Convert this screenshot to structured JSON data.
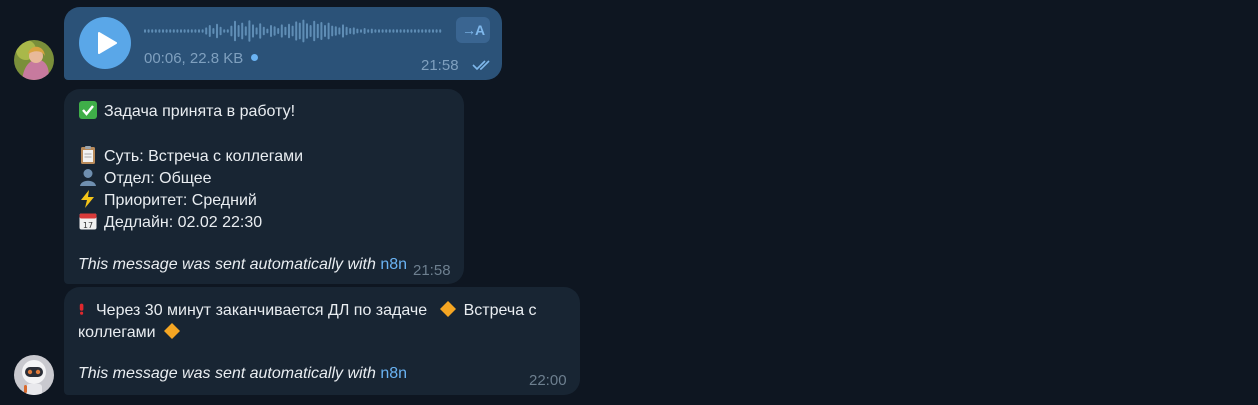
{
  "voice_message": {
    "duration_size": "00:06, 22.8 KB",
    "time": "21:58",
    "transcribe_label": "→A",
    "waveform": [
      0.15,
      0.15,
      0.15,
      0.15,
      0.15,
      0.15,
      0.15,
      0.15,
      0.15,
      0.15,
      0.15,
      0.15,
      0.15,
      0.15,
      0.15,
      0.15,
      0.15,
      0.3,
      0.5,
      0.25,
      0.6,
      0.35,
      0.15,
      0.15,
      0.45,
      0.85,
      0.5,
      0.7,
      0.4,
      0.9,
      0.55,
      0.3,
      0.65,
      0.35,
      0.2,
      0.5,
      0.4,
      0.25,
      0.55,
      0.35,
      0.6,
      0.45,
      0.8,
      0.7,
      0.95,
      0.65,
      0.5,
      0.85,
      0.6,
      0.75,
      0.5,
      0.7,
      0.45,
      0.4,
      0.3,
      0.55,
      0.35,
      0.25,
      0.3,
      0.2,
      0.15,
      0.25,
      0.15,
      0.2,
      0.15,
      0.15,
      0.15,
      0.15,
      0.15,
      0.15,
      0.15,
      0.15,
      0.15,
      0.15,
      0.15,
      0.15,
      0.15,
      0.15,
      0.15,
      0.15,
      0.15,
      0.15,
      0.15
    ]
  },
  "task_message": {
    "title": "Задача принята в работу!",
    "essence": "Суть: Встреча с коллегами",
    "department": "Отдел: Общее",
    "priority": "Приоритет: Средний",
    "deadline": "Дедлайн: 02.02 22:30",
    "footer_text": "This message was sent automatically with",
    "footer_link": "n8n",
    "time": "21:58"
  },
  "reminder_message": {
    "line1": "Через 30 минут заканчивается ДЛ по задаче",
    "task_name_a": "Встреча с",
    "task_name_b": "коллегами",
    "footer_text": "This message was sent automatically with",
    "footer_link": "n8n",
    "time": "22:00"
  },
  "colors": {
    "background": "#0e1621",
    "outgoing_bubble": "#2b5278",
    "incoming_bubble": "#182533",
    "accent": "#5aa7e8",
    "link": "#6ab3f3"
  },
  "icons": [
    "play-icon",
    "transcribe-icon",
    "double-check-icon",
    "check-mark-emoji",
    "clipboard-emoji",
    "person-emoji",
    "lightning-emoji",
    "calendar-emoji",
    "exclamation-emoji",
    "orange-diamond-emoji"
  ]
}
